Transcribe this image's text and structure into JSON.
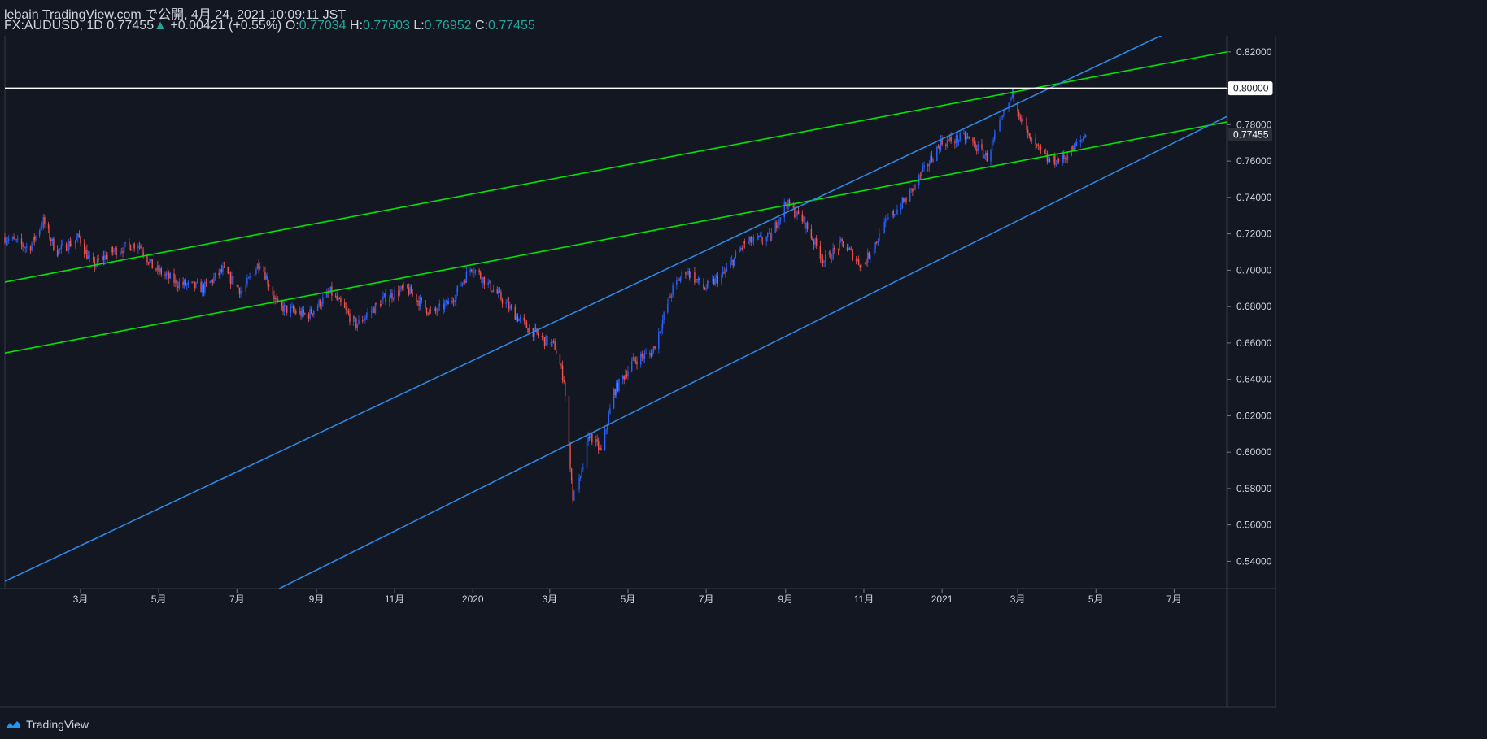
{
  "header": {
    "line1": "lebain TradingView.com で公開, 4月 24, 2021 10:09:11 JST",
    "symbol_interval": "FX:AUDUSD, 1D",
    "last": "0.77455",
    "change": "+0.00421 (+0.55%)",
    "o_label": "O:",
    "o_value": "0.77034",
    "h_label": "H:",
    "h_value": "0.77603",
    "l_label": "L:",
    "l_value": "0.76952",
    "c_label": "C:",
    "c_value": "0.77455"
  },
  "footer": {
    "brand": "TradingView"
  },
  "chart_data": {
    "type": "candlestick",
    "symbol": "FX:AUDUSD",
    "interval": "1D",
    "y_range": [
      0.525,
      0.832
    ],
    "y_ticks": [
      "0.82000",
      "0.80000",
      "0.78000",
      "0.76000",
      "0.74000",
      "0.72000",
      "0.70000",
      "0.68000",
      "0.66000",
      "0.64000",
      "0.62000",
      "0.60000",
      "0.58000",
      "0.56000",
      "0.54000"
    ],
    "price_labels": [
      {
        "value": 0.8,
        "text": "0.80000",
        "style": "white-level"
      },
      {
        "value": 0.77455,
        "text": "0.77455",
        "style": "last-price"
      }
    ],
    "x_range": [
      "2019-01-01",
      "2021-08-11"
    ],
    "x_ticks": [
      {
        "date": "2019-03-01",
        "label": "3月"
      },
      {
        "date": "2019-05-01",
        "label": "5月"
      },
      {
        "date": "2019-07-01",
        "label": "7月"
      },
      {
        "date": "2019-09-01",
        "label": "9月"
      },
      {
        "date": "2019-11-01",
        "label": "11月"
      },
      {
        "date": "2020-01-01",
        "label": "2020"
      },
      {
        "date": "2020-03-01",
        "label": "3月"
      },
      {
        "date": "2020-05-01",
        "label": "5月"
      },
      {
        "date": "2020-07-01",
        "label": "7月"
      },
      {
        "date": "2020-09-01",
        "label": "9月"
      },
      {
        "date": "2020-11-01",
        "label": "11月"
      },
      {
        "date": "2021-01-01",
        "label": "2021"
      },
      {
        "date": "2021-03-01",
        "label": "3月"
      },
      {
        "date": "2021-05-01",
        "label": "5月"
      },
      {
        "date": "2021-07-01",
        "label": "7月"
      }
    ],
    "price_path": [
      [
        "2019-01-01",
        0.718
      ],
      [
        "2019-01-20",
        0.712
      ],
      [
        "2019-01-31",
        0.727
      ],
      [
        "2019-02-10",
        0.71
      ],
      [
        "2019-02-28",
        0.718
      ],
      [
        "2019-03-10",
        0.702
      ],
      [
        "2019-03-25",
        0.71
      ],
      [
        "2019-04-15",
        0.715
      ],
      [
        "2019-04-26",
        0.702
      ],
      [
        "2019-05-15",
        0.693
      ],
      [
        "2019-06-05",
        0.69
      ],
      [
        "2019-06-20",
        0.7
      ],
      [
        "2019-07-05",
        0.688
      ],
      [
        "2019-07-19",
        0.705
      ],
      [
        "2019-08-02",
        0.68
      ],
      [
        "2019-08-25",
        0.675
      ],
      [
        "2019-09-12",
        0.688
      ],
      [
        "2019-10-02",
        0.67
      ],
      [
        "2019-10-25",
        0.685
      ],
      [
        "2019-11-10",
        0.69
      ],
      [
        "2019-11-30",
        0.676
      ],
      [
        "2019-12-15",
        0.683
      ],
      [
        "2019-12-31",
        0.702
      ],
      [
        "2020-01-20",
        0.687
      ],
      [
        "2020-02-10",
        0.67
      ],
      [
        "2020-02-25",
        0.662
      ],
      [
        "2020-03-05",
        0.658
      ],
      [
        "2020-03-12",
        0.64
      ],
      [
        "2020-03-19",
        0.575
      ],
      [
        "2020-03-25",
        0.585
      ],
      [
        "2020-04-01",
        0.61
      ],
      [
        "2020-04-10",
        0.6
      ],
      [
        "2020-04-20",
        0.633
      ],
      [
        "2020-05-05",
        0.65
      ],
      [
        "2020-05-20",
        0.655
      ],
      [
        "2020-06-05",
        0.69
      ],
      [
        "2020-06-15",
        0.7
      ],
      [
        "2020-06-30",
        0.69
      ],
      [
        "2020-07-15",
        0.698
      ],
      [
        "2020-07-31",
        0.715
      ],
      [
        "2020-08-20",
        0.718
      ],
      [
        "2020-09-01",
        0.737
      ],
      [
        "2020-09-15",
        0.727
      ],
      [
        "2020-10-01",
        0.705
      ],
      [
        "2020-10-15",
        0.715
      ],
      [
        "2020-10-31",
        0.702
      ],
      [
        "2020-11-20",
        0.728
      ],
      [
        "2020-12-05",
        0.74
      ],
      [
        "2020-12-31",
        0.77
      ],
      [
        "2021-01-20",
        0.773
      ],
      [
        "2021-02-05",
        0.762
      ],
      [
        "2021-02-25",
        0.797
      ],
      [
        "2021-03-10",
        0.772
      ],
      [
        "2021-03-25",
        0.76
      ],
      [
        "2021-04-05",
        0.761
      ],
      [
        "2021-04-15",
        0.768
      ],
      [
        "2021-04-23",
        0.7745
      ]
    ],
    "lines": [
      {
        "color": "#00e600",
        "from": [
          "2019-01-01",
          0.6935
        ],
        "to": [
          "2021-08-11",
          0.82
        ]
      },
      {
        "color": "#00e600",
        "from": [
          "2019-01-01",
          0.6545
        ],
        "to": [
          "2021-08-11",
          0.7815
        ]
      },
      {
        "color": "#2e86de",
        "from": [
          "2019-01-01",
          0.529
        ],
        "to": [
          "2021-06-30",
          0.832
        ]
      },
      {
        "color": "#2e86de",
        "from": [
          "2019-08-03",
          0.525
        ],
        "to": [
          "2021-08-11",
          0.7845
        ]
      },
      {
        "color": "#ffffff",
        "from": [
          "2019-01-01",
          0.8
        ],
        "to": [
          "2021-08-11",
          0.8
        ]
      }
    ],
    "up_color": "#2962ff",
    "down_color": "#ef5350"
  }
}
